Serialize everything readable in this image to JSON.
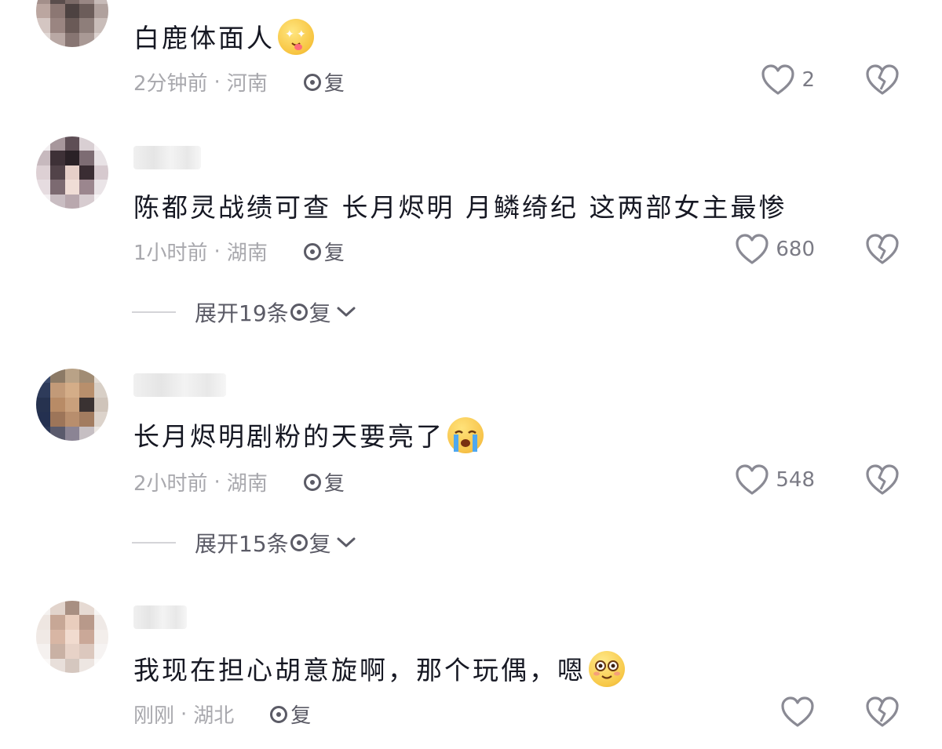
{
  "comments": [
    {
      "text": "白鹿体面人",
      "emoji": "star-eyes-tongue-emoji",
      "time": "2分钟前",
      "location": "河南",
      "reply_label": "复",
      "likes": "2"
    },
    {
      "text": "陈都灵战绩可查  长月烬明  月鳞绮纪  这两部女主最惨",
      "time": "1小时前",
      "location": "湖南",
      "reply_label": "复",
      "likes": "680",
      "expand_label": "展开19条",
      "expand_reply": "复"
    },
    {
      "text": "长月烬明剧粉的天要亮了",
      "emoji": "crying-face-emoji",
      "time": "2小时前",
      "location": "湖南",
      "reply_label": "复",
      "likes": "548",
      "expand_label": "展开15条",
      "expand_reply": "复"
    },
    {
      "text": "我现在担心胡意旋啊，那个玩偶，嗯",
      "emoji": "flushed-face-emoji",
      "time": "刚刚",
      "location": "湖北",
      "reply_label": "复"
    }
  ],
  "meta_separator": "·",
  "colors": {
    "text": "#161823",
    "meta": "#a8a8ad",
    "icon": "#5b5b66"
  }
}
